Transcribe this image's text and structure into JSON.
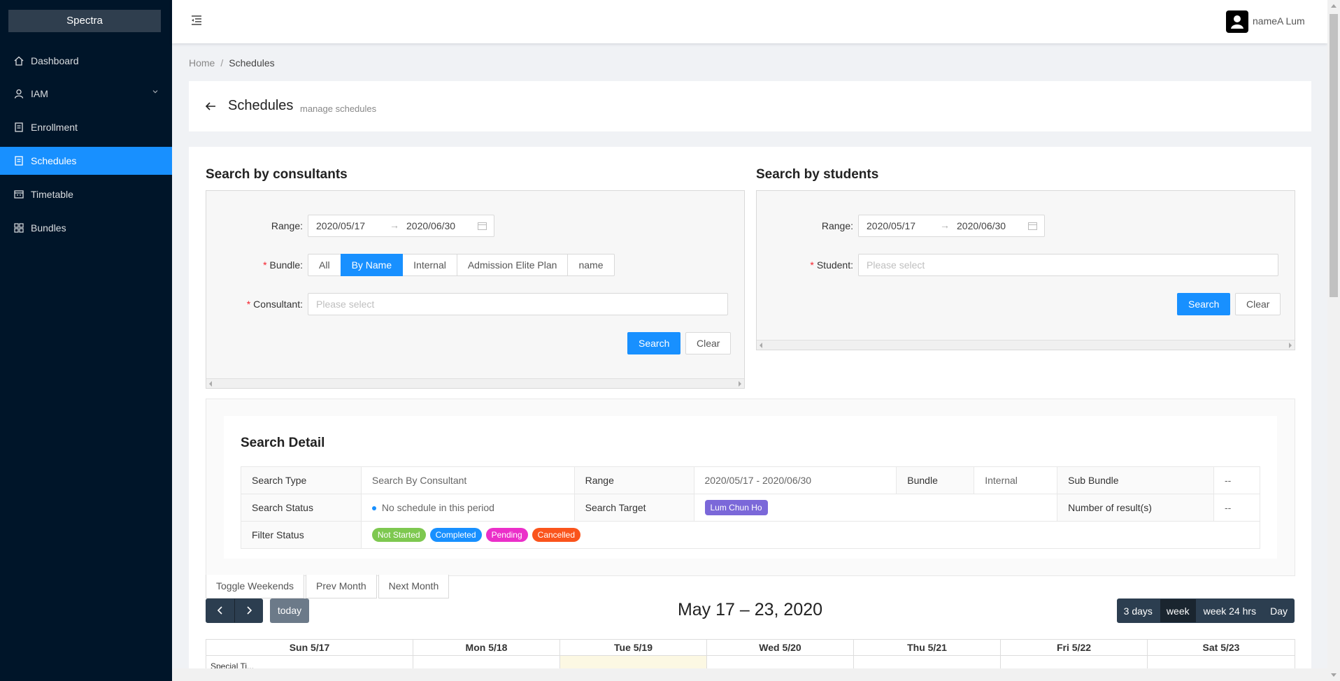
{
  "app": {
    "name": "Spectra"
  },
  "sidebar": {
    "items": [
      {
        "label": "Dashboard",
        "icon": "home-icon"
      },
      {
        "label": "IAM",
        "icon": "user-icon"
      },
      {
        "label": "Enrollment",
        "icon": "file-icon"
      },
      {
        "label": "Schedules",
        "icon": "file-icon",
        "active": true
      },
      {
        "label": "Timetable",
        "icon": "calendar-icon"
      },
      {
        "label": "Bundles",
        "icon": "apps-icon"
      }
    ]
  },
  "header": {
    "username": "nameA Lum"
  },
  "breadcrumb": {
    "home": "Home",
    "sep": "/",
    "current": "Schedules"
  },
  "page": {
    "title": "Schedules",
    "subtitle": "manage schedules"
  },
  "consultants": {
    "title": "Search by consultants",
    "range_label": "Range",
    "range_from": "2020/05/17",
    "range_arrow": "→",
    "range_to": "2020/06/30",
    "bundle_label": "Bundle",
    "bundle_options": [
      "All",
      "By Name",
      "Internal",
      "Admission Elite Plan",
      "name"
    ],
    "bundle_selected": "By Name",
    "consultant_label": "Consultant",
    "consultant_placeholder": "Please select",
    "search_label": "Search",
    "clear_label": "Clear"
  },
  "students": {
    "title": "Search by students",
    "range_label": "Range",
    "range_from": "2020/05/17",
    "range_arrow": "→",
    "range_to": "2020/06/30",
    "student_label": "Student",
    "student_placeholder": "Please select",
    "search_label": "Search",
    "clear_label": "Clear"
  },
  "detail": {
    "title": "Search Detail",
    "search_type_label": "Search Type",
    "search_type": "Search By Consultant",
    "range_label": "Range",
    "range": "2020/05/17 - 2020/06/30",
    "bundle_label": "Bundle",
    "bundle": "Internal",
    "sub_bundle_label": "Sub Bundle",
    "sub_bundle": "--",
    "status_label": "Search Status",
    "status": "No schedule in this period",
    "target_label": "Search Target",
    "target": "Lum Chun Ho",
    "results_label": "Number of result(s)",
    "results": "--",
    "filter_label": "Filter Status",
    "filters": [
      {
        "label": "Not Started",
        "color": "#7ec850"
      },
      {
        "label": "Completed",
        "color": "#1890ff"
      },
      {
        "label": "Pending",
        "color": "#eb2fc9"
      },
      {
        "label": "Cancelled",
        "color": "#fa541c"
      }
    ],
    "target_color": "#7b68d9"
  },
  "calendar": {
    "tabs": [
      "Toggle Weekends",
      "Prev Month",
      "Next Month"
    ],
    "prev_icon": "chevron-left-icon",
    "next_icon": "chevron-right-icon",
    "today_label": "today",
    "title": "May 17 – 23, 2020",
    "views": [
      "3 days",
      "week",
      "week 24 hrs",
      "Day"
    ],
    "active_view": "week",
    "days": [
      "Sun 5/17",
      "Mon 5/18",
      "Tue 5/19",
      "Wed 5/20",
      "Thu 5/21",
      "Fri 5/22",
      "Sat 5/23"
    ],
    "today": "Tue 5/19",
    "special_label": "Special Ti..."
  }
}
